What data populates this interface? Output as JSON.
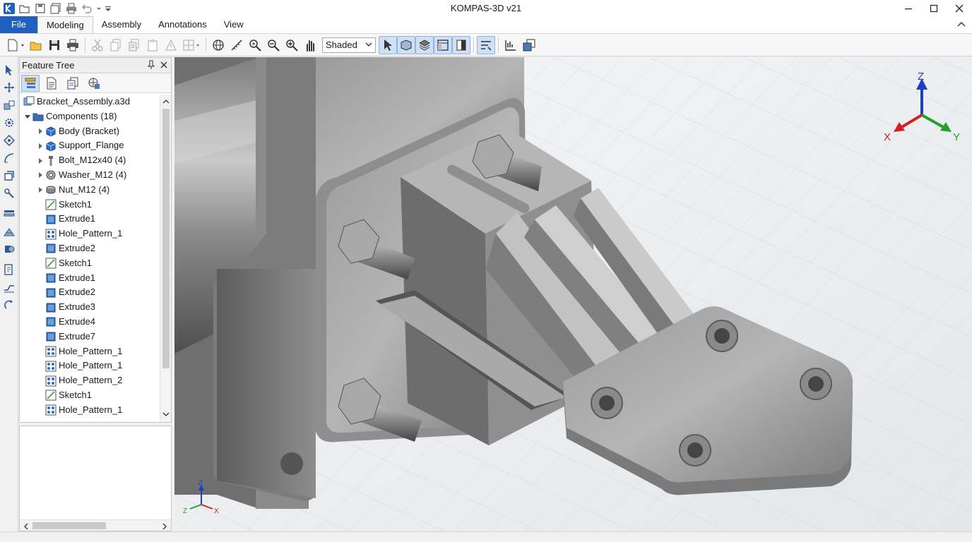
{
  "app": {
    "title": "KOMPAS-3D v21",
    "logo_icon": "kompas-logo-icon"
  },
  "quick_access": [
    "open-icon",
    "save-icon",
    "save-all-icon",
    "print-icon",
    "undo-icon",
    "undo-dropdown-icon",
    "customize-qa-icon"
  ],
  "menu": {
    "tabs": [
      {
        "label": "File",
        "active": false
      },
      {
        "label": "Modeling",
        "active": true
      },
      {
        "label": "Assembly",
        "active": false
      },
      {
        "label": "Annotations",
        "active": false
      },
      {
        "label": "View",
        "active": false
      }
    ]
  },
  "toolbar": {
    "display_mode": "Shaded",
    "buttons": [
      "new-icon",
      "open-icon",
      "save-icon",
      "print-icon",
      "cut-icon",
      "copy-icon",
      "copy-properties-icon",
      "paste-icon",
      "paste-special-icon",
      "grid-icon",
      "globe-icon",
      "measure-icon",
      "zoom-window-icon",
      "zoom-out-icon",
      "zoom-in-icon",
      "pan-icon"
    ]
  },
  "feature_tree": {
    "title": "Feature Tree",
    "items": [
      {
        "label": "Bracket_Assembly.a3d",
        "icon": "assembly-icon",
        "level": 0,
        "expander": ""
      },
      {
        "label": "Components (18)",
        "icon": "folder-icon",
        "level": 1,
        "expander": "open"
      },
      {
        "label": "Body (Bracket)",
        "icon": "part-icon",
        "level": 2,
        "expander": "closed"
      },
      {
        "label": "Support_Flange",
        "icon": "part-icon",
        "level": 2,
        "expander": "closed"
      },
      {
        "label": "Bolt_M12x40 (4)",
        "icon": "bolt-icon",
        "level": 2,
        "expander": "closed"
      },
      {
        "label": "Washer_M12 (4)",
        "icon": "washer-icon",
        "level": 2,
        "expander": "closed"
      },
      {
        "label": "Nut_M12 (4)",
        "icon": "nut-icon",
        "level": 2,
        "expander": "closed"
      },
      {
        "label": "Sketch1",
        "icon": "sketch-icon",
        "level": 2,
        "expander": ""
      },
      {
        "label": "Extrude1",
        "icon": "extrude-icon",
        "level": 2,
        "expander": ""
      },
      {
        "label": "Hole_Pattern_1",
        "icon": "hole-pattern-icon",
        "level": 2,
        "expander": ""
      },
      {
        "label": "Extrude2",
        "icon": "extrude-icon",
        "level": 2,
        "expander": ""
      },
      {
        "label": "Sketch1",
        "icon": "sketch-icon",
        "level": 2,
        "expander": ""
      },
      {
        "label": "Extrude1",
        "icon": "extrude-icon",
        "level": 2,
        "expander": ""
      },
      {
        "label": "Extrude2",
        "icon": "extrude-icon",
        "level": 2,
        "expander": ""
      },
      {
        "label": "Extrude3",
        "icon": "extrude-icon",
        "level": 2,
        "expander": ""
      },
      {
        "label": "Extrude4",
        "icon": "extrude-icon",
        "level": 2,
        "expander": ""
      },
      {
        "label": "Extrude7",
        "icon": "extrude-icon",
        "level": 2,
        "expander": ""
      },
      {
        "label": "Hole_Pattern_1",
        "icon": "hole-pattern-icon",
        "level": 2,
        "expander": ""
      },
      {
        "label": "Hole_Pattern_1",
        "icon": "hole-pattern-icon",
        "level": 2,
        "expander": ""
      },
      {
        "label": "Hole_Pattern_2",
        "icon": "hole-pattern-icon",
        "level": 2,
        "expander": ""
      },
      {
        "label": "Sketch1",
        "icon": "sketch-icon",
        "level": 2,
        "expander": ""
      },
      {
        "label": "Hole_Pattern_1",
        "icon": "hole-pattern-icon",
        "level": 2,
        "expander": ""
      }
    ]
  },
  "view_triad": {
    "x": "X",
    "y": "Y",
    "z": "Z"
  },
  "mini_triad": {
    "x": "X",
    "y": "Z",
    "z": "Z"
  },
  "colors": {
    "file_tab": "#1f5fbf",
    "axis_x": "#d42020",
    "axis_y": "#22a02a",
    "axis_z": "#1a3fc9",
    "part_blue": "#2e6fc4"
  }
}
